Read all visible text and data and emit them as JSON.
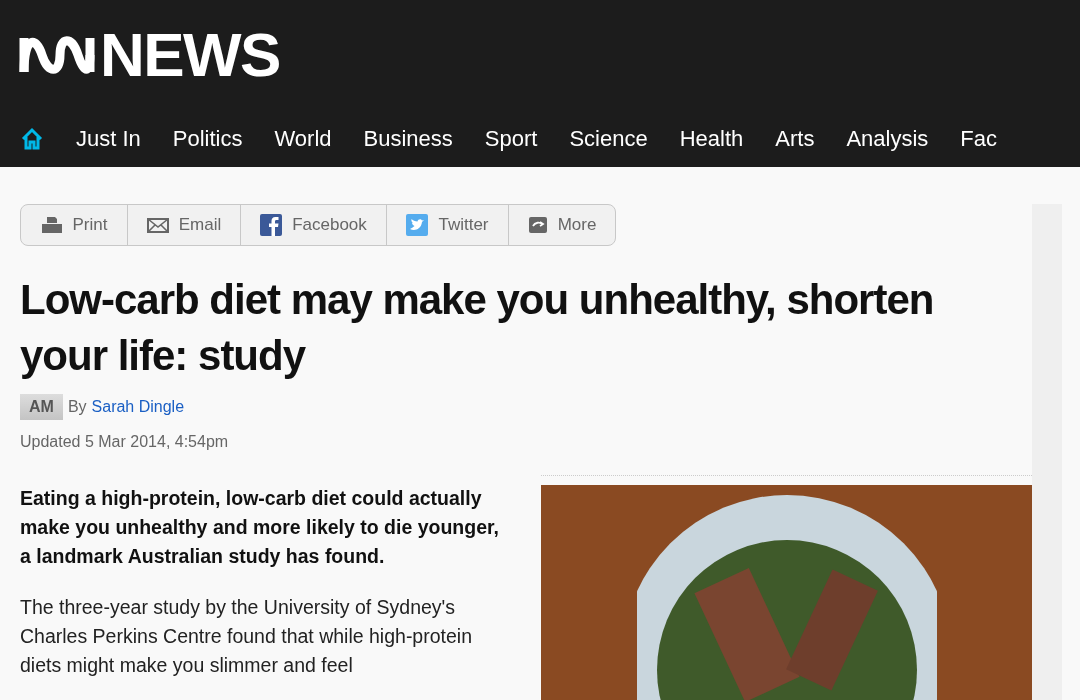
{
  "header": {
    "logo_text": "NEWS"
  },
  "nav": {
    "items": [
      {
        "label": "Just In"
      },
      {
        "label": "Politics"
      },
      {
        "label": "World"
      },
      {
        "label": "Business"
      },
      {
        "label": "Sport"
      },
      {
        "label": "Science"
      },
      {
        "label": "Health"
      },
      {
        "label": "Arts"
      },
      {
        "label": "Analysis"
      },
      {
        "label": "Fac"
      }
    ]
  },
  "share_bar": {
    "buttons": [
      {
        "kind": "print",
        "label": "Print"
      },
      {
        "kind": "email",
        "label": "Email"
      },
      {
        "kind": "facebook",
        "label": "Facebook"
      },
      {
        "kind": "twitter",
        "label": "Twitter"
      },
      {
        "kind": "more",
        "label": "More"
      }
    ]
  },
  "article": {
    "title": "Low-carb diet may make you unhealthy, shorten your life: study",
    "program_badge": "AM",
    "by": "By",
    "author": "Sarah Dingle",
    "updated": "Updated 5 Mar 2014, 4:54pm",
    "lead": "Eating a high-protein, low-carb diet could actually make you unhealthy and more likely to die younger, a landmark Australian study has found.",
    "body": "The three-year study by the University of Sydney's Charles Perkins Centre found that while high-protein diets might make you slimmer and feel"
  }
}
